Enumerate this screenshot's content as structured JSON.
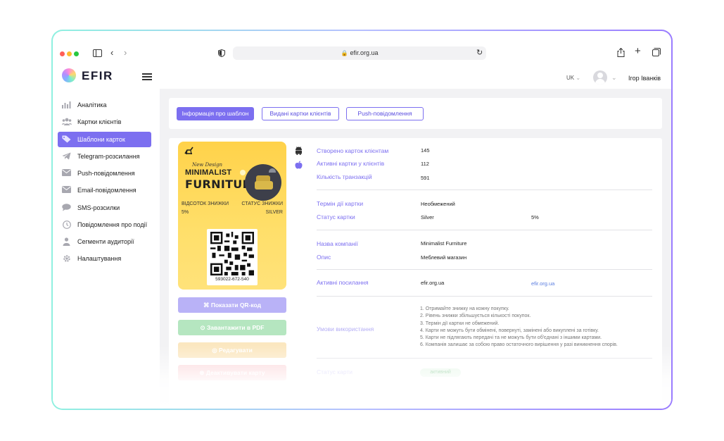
{
  "browser": {
    "url": "efir.org.ua",
    "colors": {
      "close": "#ff5f57",
      "minimize": "#febc2e",
      "maximize": "#28c840"
    }
  },
  "header": {
    "logo": "EFIR",
    "lang": "UK",
    "user": "Ігор Іванків"
  },
  "sidebar": {
    "items": [
      {
        "label": "Аналітика",
        "icon": "chart-icon"
      },
      {
        "label": "Картки клієнтів",
        "icon": "users-icon"
      },
      {
        "label": "Шаблони карток",
        "icon": "tag-icon",
        "active": true
      },
      {
        "label": "Telegram-розсилання",
        "icon": "telegram-icon"
      },
      {
        "label": "Push-повідомлення",
        "icon": "mail-icon"
      },
      {
        "label": "Email-повідомлення",
        "icon": "mail-icon"
      },
      {
        "label": "SMS-розсилки",
        "icon": "chat-icon"
      },
      {
        "label": "Повідомлення про події",
        "icon": "clock-icon"
      },
      {
        "label": "Сегменти аудиторії",
        "icon": "person-icon"
      },
      {
        "label": "Налаштування",
        "icon": "gear-icon"
      }
    ]
  },
  "tabs": [
    {
      "label": "Інформація про шаблон",
      "active": true
    },
    {
      "label": "Видані картки клієнтів"
    },
    {
      "label": "Push-повідомлення"
    }
  ],
  "card": {
    "tagline": "New Design",
    "brand_line1": "MINIMALIST",
    "brand_line2": "FURNITURE",
    "discount_label": "ВІДСОТОК ЗНИЖКИ",
    "discount_value": "5%",
    "status_label": "СТАТУС ЗНИЖКИ",
    "status_value": "SILVER",
    "qr_number": "593022-672-540",
    "color": "#ffd24a"
  },
  "actions": {
    "show_qr": "Показати QR-код",
    "download_pdf": "Завантажити в PDF",
    "edit": "Редагувати",
    "deactivate": "Деактивувати карту"
  },
  "info": {
    "created_label": "Створено карток клієнтам",
    "created_value": "145",
    "active_label": "Активні картки у клієнтів",
    "active_value": "112",
    "transactions_label": "Кількість транзакцій",
    "transactions_value": "591",
    "term_label": "Термін дії картки",
    "term_value": "Необмежений",
    "status_label": "Статус картки",
    "status_value": "Silver",
    "status_percent": "5%",
    "company_label": "Назва компанії",
    "company_value": "Minimalist Furniture",
    "description_label": "Опис",
    "description_value": "Меблевий магазин",
    "links_label": "Активні посилання",
    "links_value": "efir.org.ua",
    "links_link": "efir.org.ua",
    "terms_label": "Умови використання",
    "terms": [
      "1. Отримайте знижку на кожну покупку.",
      "2. Рівень знижки збільшується кількості покупок.",
      "3. Термін дії картки не обмежений.",
      "4. Карти не можуть бути обмінені, повернуті, замінені або викуплені за готівку.",
      "5. Карти не підлягають передачі та не можуть бути об'єднані з іншими картами.",
      "6. Компанія залишає за собою право остаточного вирішення у разі виникнення спорів."
    ],
    "card_status_label": "Статус карти",
    "card_status_value": "активний"
  }
}
